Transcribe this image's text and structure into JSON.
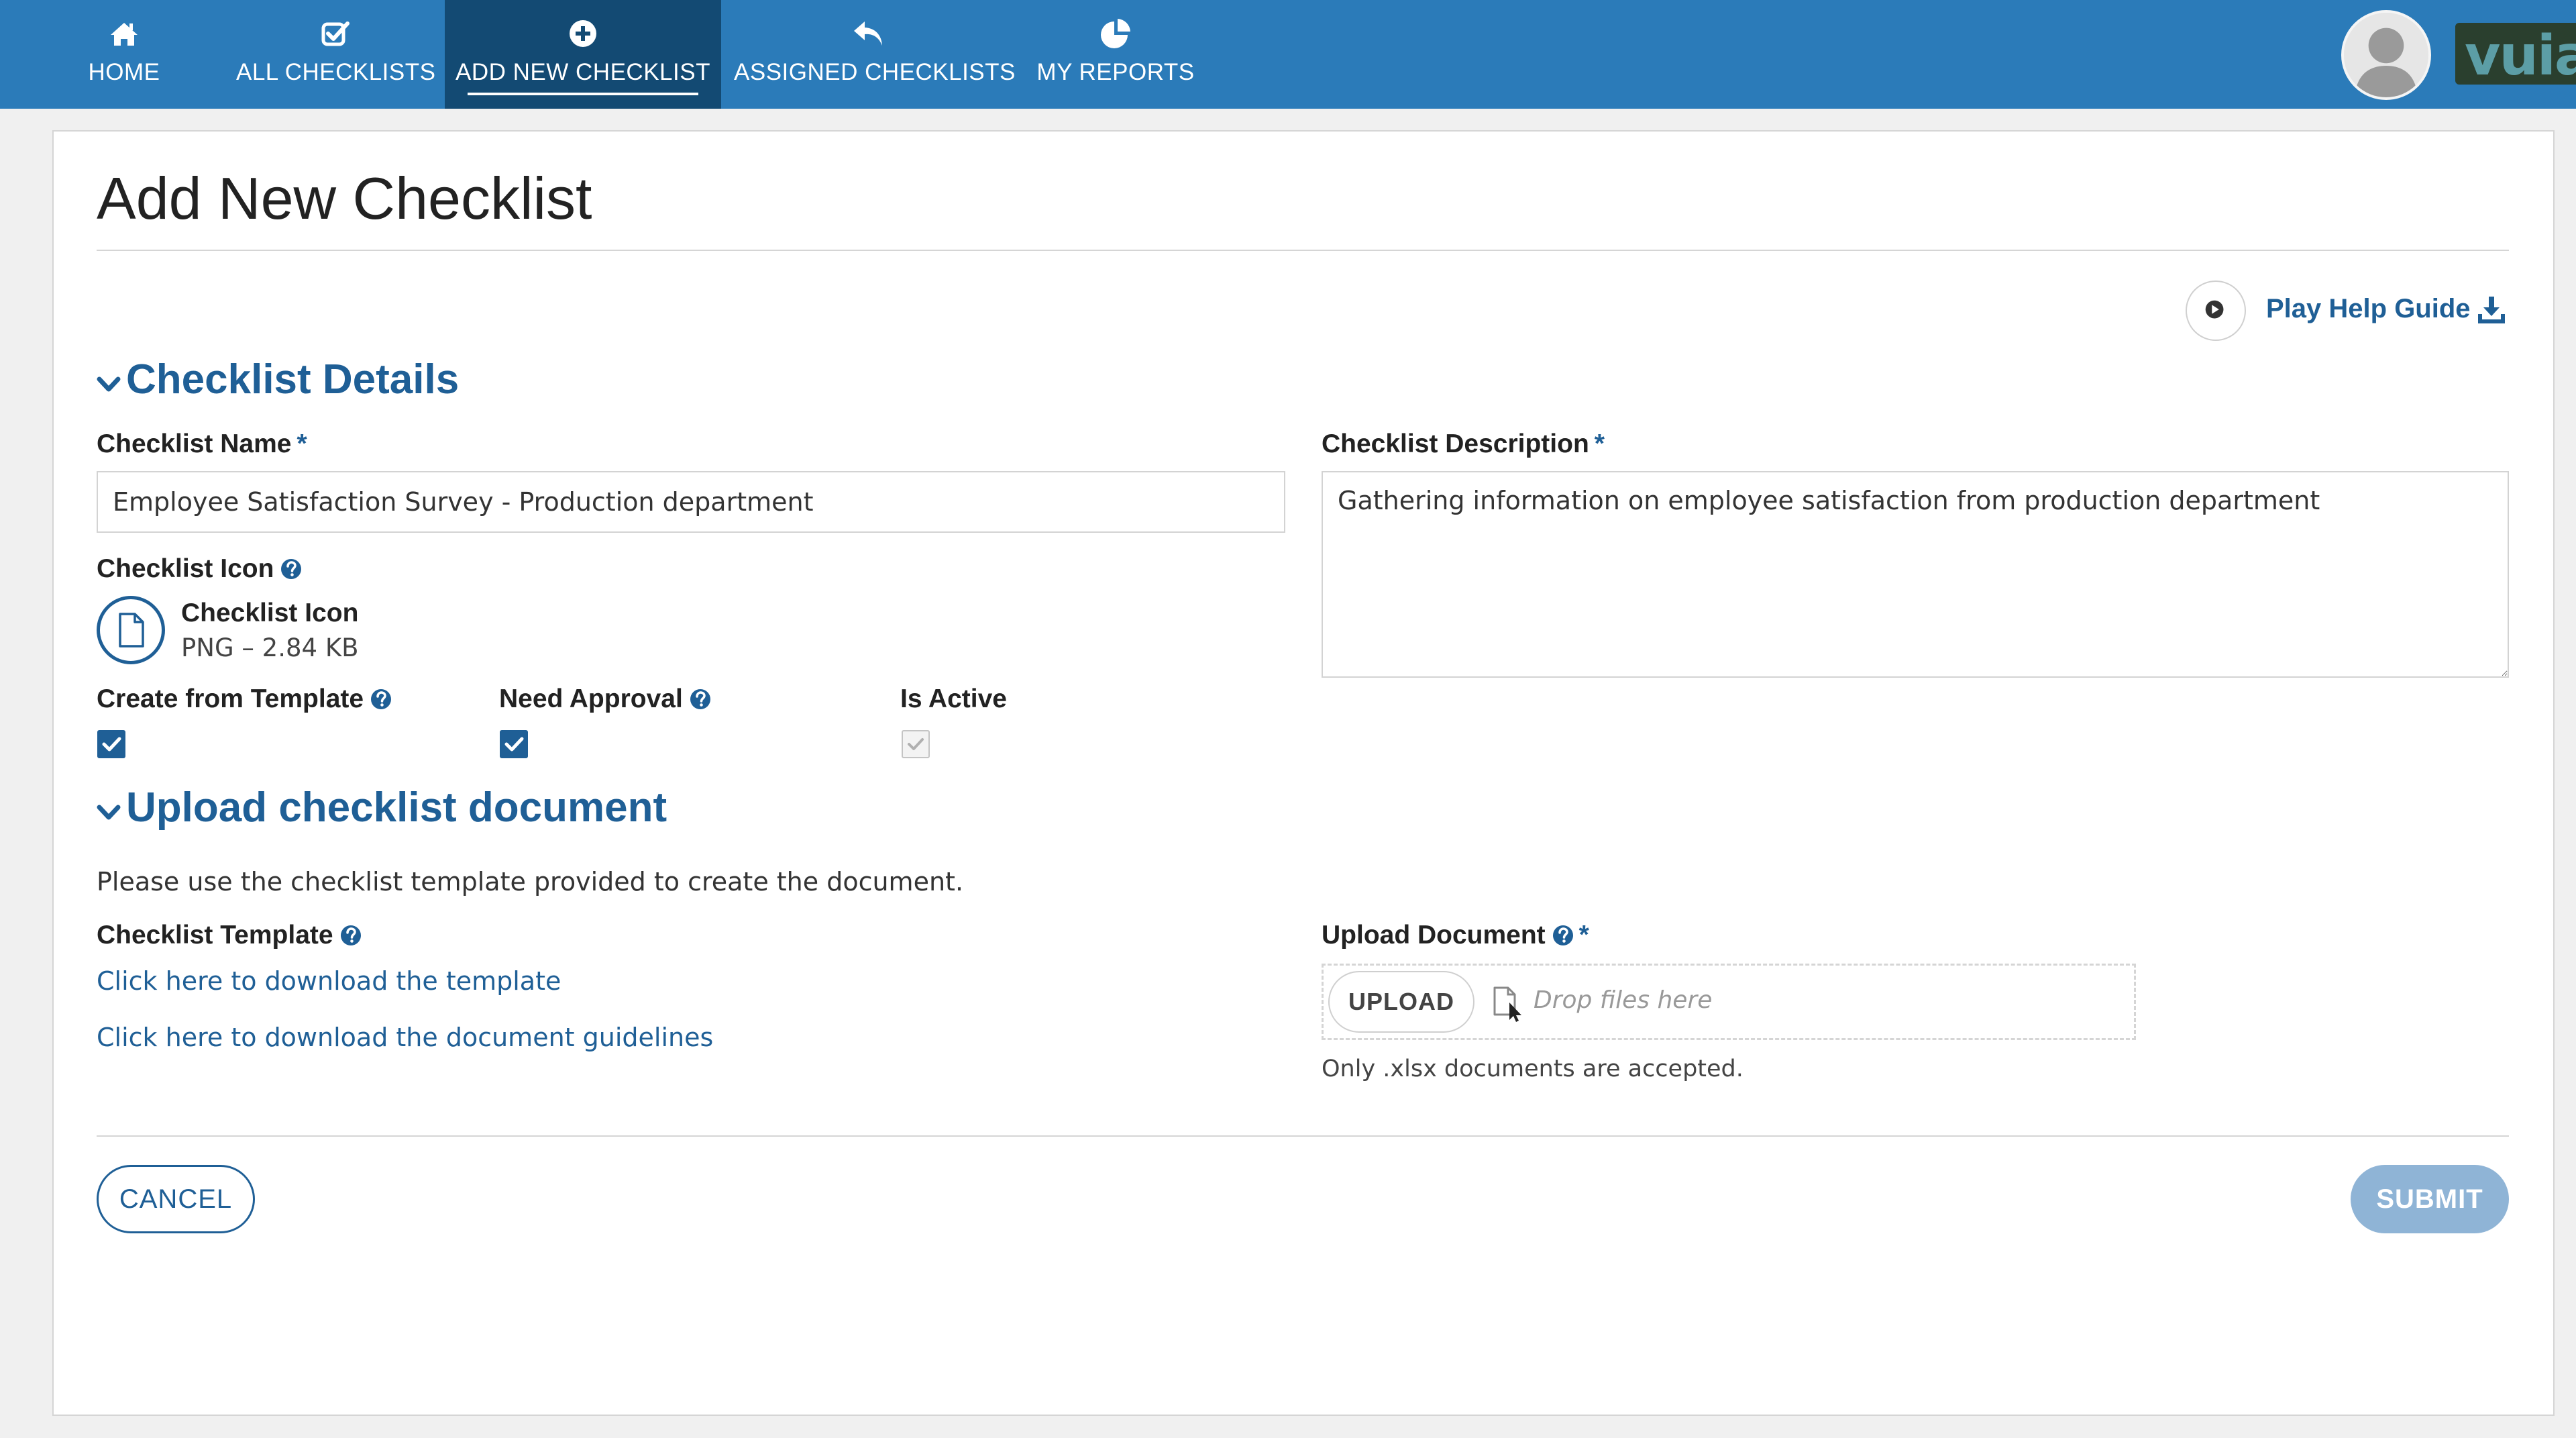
{
  "nav": {
    "items": [
      {
        "label": "HOME",
        "icon": "home-icon"
      },
      {
        "label": "ALL CHECKLISTS",
        "icon": "checklist-icon"
      },
      {
        "label": "ADD NEW CHECKLIST",
        "icon": "plus-circle-icon",
        "active": true
      },
      {
        "label": "ASSIGNED CHECKLISTS",
        "icon": "reply-arrow-icon"
      },
      {
        "label": "MY REPORTS",
        "icon": "pie-chart-icon"
      }
    ],
    "logo_text": "vuiam"
  },
  "page": {
    "title": "Add New Checklist",
    "help_guide_label": "Play Help Guide"
  },
  "details": {
    "section_title": "Checklist Details",
    "name_label": "Checklist Name",
    "name_value": "Employee Satisfaction Survey - Production department",
    "description_label": "Checklist Description",
    "description_value": "Gathering information on employee satisfaction from production department",
    "required_mark": "*",
    "icon_label": "Checklist Icon",
    "icon_file_name": "Checklist Icon",
    "icon_file_meta": "PNG – 2.84 KB",
    "create_from_template_label": "Create from Template",
    "create_from_template_checked": true,
    "need_approval_label": "Need Approval",
    "need_approval_checked": true,
    "is_active_label": "Is Active",
    "is_active_checked": true
  },
  "upload": {
    "section_title": "Upload checklist document",
    "instruction": "Please use the checklist template provided to create the document.",
    "template_label": "Checklist Template",
    "download_template_link": "Click here to download the template",
    "download_guidelines_link": "Click here to download the document guidelines",
    "upload_label": "Upload Document",
    "upload_button": "UPLOAD",
    "drop_placeholder": "Drop files here",
    "accepted_note": "Only .xlsx documents are accepted."
  },
  "actions": {
    "cancel": "CANCEL",
    "submit": "SUBMIT"
  },
  "colors": {
    "nav_bg": "#2b7bb9",
    "nav_active_bg": "#134a73",
    "accent": "#1f5f96",
    "submit_disabled": "#8fb4d6"
  }
}
